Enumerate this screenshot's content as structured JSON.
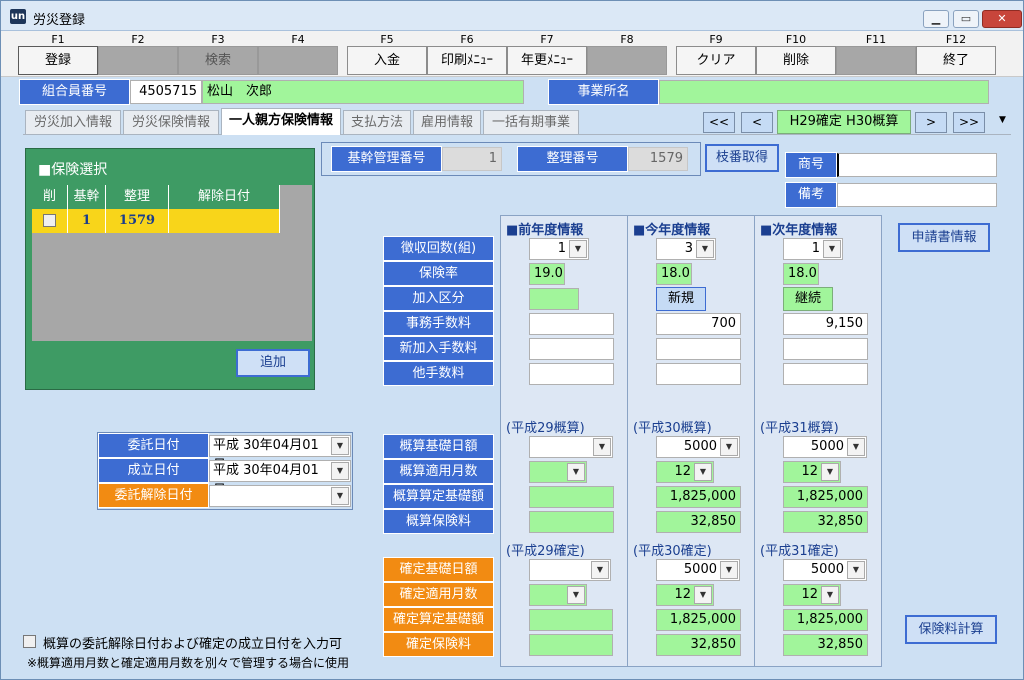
{
  "window": {
    "title": "労災登録",
    "icon_text": "un",
    "min": "▁",
    "max": "▭",
    "close": "✕"
  },
  "fkeys": [
    {
      "key": "F1",
      "label": "登録",
      "state": "normal"
    },
    {
      "key": "F2",
      "label": "",
      "state": "disabled"
    },
    {
      "key": "F3",
      "label": "検索",
      "state": "disabled"
    },
    {
      "key": "F4",
      "label": "",
      "state": "disabled"
    },
    {
      "key": "F5",
      "label": "入金",
      "state": "normal"
    },
    {
      "key": "F6",
      "label": "印刷ﾒﾆｭｰ",
      "state": "normal"
    },
    {
      "key": "F7",
      "label": "年更ﾒﾆｭｰ",
      "state": "normal"
    },
    {
      "key": "F8",
      "label": "",
      "state": "disabled"
    },
    {
      "key": "F9",
      "label": "クリア",
      "state": "normal"
    },
    {
      "key": "F10",
      "label": "削除",
      "state": "normal"
    },
    {
      "key": "F11",
      "label": "",
      "state": "disabled"
    },
    {
      "key": "F12",
      "label": "終了",
      "state": "normal"
    }
  ],
  "header": {
    "member_label": "組合員番号",
    "member_no": "4505715",
    "member_name": "松山　次郎",
    "office_label": "事業所名",
    "office_name": ""
  },
  "tabs": [
    "労災加入情報",
    "労災保険情報",
    "一人親方保険情報",
    "支払方法",
    "雇用情報",
    "一括有期事業"
  ],
  "active_tab": 2,
  "nav": {
    "first": "<<",
    "prev": "<",
    "period": "H29確定 H30概算",
    "next": ">",
    "last": ">>",
    "menu": "▼"
  },
  "kanri": {
    "kikan_label": "基幹管理番号",
    "kikan_value": "1",
    "seiri_label": "整理番号",
    "seiri_value": "1579",
    "edaban_button": "枝番取得"
  },
  "shogo": {
    "label": "商号",
    "value": ""
  },
  "biko": {
    "label": "備考",
    "value": ""
  },
  "shinsei_button": "申請書情報",
  "hoken_sentaku": {
    "title": "■保険選択",
    "cols": [
      "削",
      "基幹",
      "整理",
      "解除日付"
    ],
    "row": {
      "del": "",
      "kikan": "1",
      "seiri": "1579",
      "date": ""
    },
    "add_button": "追加"
  },
  "dates": [
    {
      "label": "委託日付",
      "value": "平成 30年04月01日",
      "color": "blue"
    },
    {
      "label": "成立日付",
      "value": "平成 30年04月01日",
      "color": "blue"
    },
    {
      "label": "委託解除日付",
      "value": "",
      "color": "orange"
    }
  ],
  "row_labels_top": [
    "徴収回数(組)",
    "保険率",
    "加入区分",
    "事務手数料",
    "新加入手数料",
    "他手数料"
  ],
  "row_labels_gaisan": [
    "概算基礎日額",
    "概算適用月数",
    "概算算定基礎額",
    "概算保険料"
  ],
  "row_labels_kakutei": [
    "確定基礎日額",
    "確定適用月数",
    "確定算定基礎額",
    "確定保険料"
  ],
  "columns": [
    {
      "title": "■前年度情報",
      "choshu": "1",
      "rate": "19.0",
      "kubun": "",
      "jimu": "",
      "shinki": "",
      "ta": "",
      "gaisan_title": "(平成29概算)",
      "g_nichi": "",
      "g_tsuki": "",
      "g_kiso": "",
      "g_hoken": "",
      "kakutei_title": "(平成29確定)",
      "k_nichi": "",
      "k_tsuki": "",
      "k_kiso": "",
      "k_hoken": ""
    },
    {
      "title": "■今年度情報",
      "choshu": "3",
      "rate": "18.0",
      "kubun": "新規",
      "jimu": "700",
      "shinki": "",
      "ta": "",
      "gaisan_title": "(平成30概算)",
      "g_nichi": "5000",
      "g_tsuki": "12",
      "g_kiso": "1,825,000",
      "g_hoken": "32,850",
      "kakutei_title": "(平成30確定)",
      "k_nichi": "5000",
      "k_tsuki": "12",
      "k_kiso": "1,825,000",
      "k_hoken": "32,850"
    },
    {
      "title": "■次年度情報",
      "choshu": "1",
      "rate": "18.0",
      "kubun": "継続",
      "jimu": "9,150",
      "shinki": "",
      "ta": "",
      "gaisan_title": "(平成31概算)",
      "g_nichi": "5000",
      "g_tsuki": "12",
      "g_kiso": "1,825,000",
      "g_hoken": "32,850",
      "kakutei_title": "(平成31確定)",
      "k_nichi": "5000",
      "k_tsuki": "12",
      "k_kiso": "1,825,000",
      "k_hoken": "32,850"
    }
  ],
  "calc_button": "保険料計算",
  "footer": {
    "check_label": "概算の委託解除日付および確定の成立日付を入力可",
    "note": "※概算適用月数と確定適用月数を別々で管理する場合に使用"
  }
}
